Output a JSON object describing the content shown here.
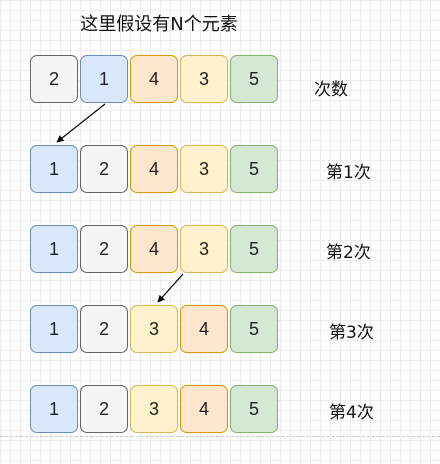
{
  "title": "这里假设有N个元素",
  "color_map": {
    "1": "#dae8fc",
    "2": "#f5f5f5",
    "3": "#fff2cc",
    "4": "#ffe6cc",
    "5": "#d5e8d4"
  },
  "rows": [
    {
      "label": "次数",
      "cells": [
        2,
        1,
        4,
        3,
        5
      ]
    },
    {
      "label": "第1次",
      "cells": [
        1,
        2,
        4,
        3,
        5
      ]
    },
    {
      "label": "第2次",
      "cells": [
        1,
        2,
        4,
        3,
        5
      ]
    },
    {
      "label": "第3次",
      "cells": [
        1,
        2,
        3,
        4,
        5
      ]
    },
    {
      "label": "第4次",
      "cells": [
        1,
        2,
        3,
        4,
        5
      ]
    }
  ]
}
